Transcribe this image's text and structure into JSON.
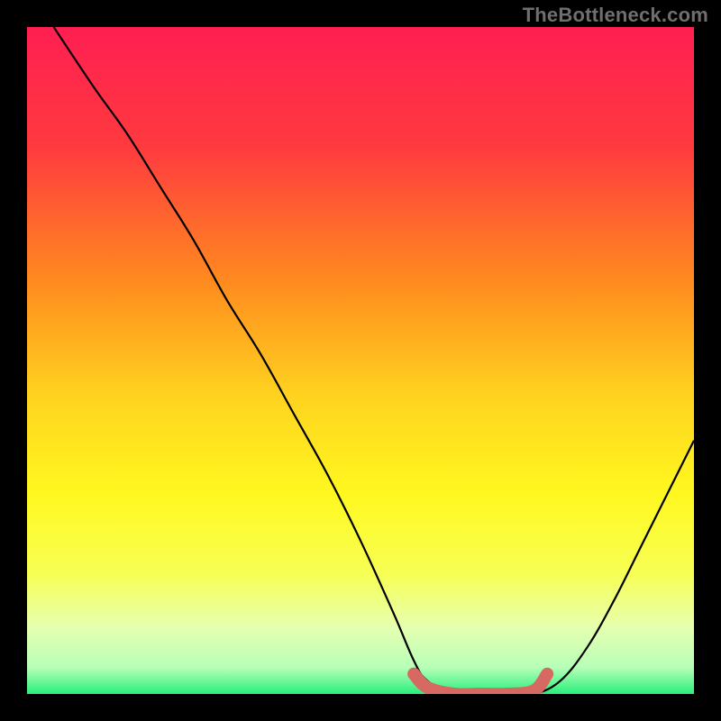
{
  "watermark": "TheBottleneck.com",
  "accent_color": "#d66a63",
  "chart_data": {
    "type": "line",
    "title": "",
    "xlabel": "",
    "ylabel": "",
    "xlim": [
      0,
      100
    ],
    "ylim": [
      0,
      100
    ],
    "series": [
      {
        "name": "curve",
        "x": [
          4,
          10,
          15,
          20,
          25,
          30,
          35,
          40,
          45,
          50,
          55,
          58,
          60,
          64,
          68,
          72,
          76,
          80,
          84,
          88,
          92,
          96,
          100
        ],
        "y": [
          100,
          91,
          84,
          76,
          68,
          59,
          51,
          42,
          33,
          23,
          12,
          5,
          2,
          0,
          0,
          0,
          0,
          2,
          7,
          14,
          22,
          30,
          38
        ]
      }
    ],
    "highlight": {
      "name": "flat-region",
      "x": [
        58,
        60,
        64,
        68,
        72,
        76,
        78
      ],
      "y": [
        3,
        1,
        0,
        0,
        0,
        0.5,
        3
      ]
    },
    "gradient_stops": [
      {
        "offset": 0.0,
        "color": "#ff1f52"
      },
      {
        "offset": 0.18,
        "color": "#ff3a3f"
      },
      {
        "offset": 0.38,
        "color": "#ff8a1f"
      },
      {
        "offset": 0.55,
        "color": "#ffd21f"
      },
      {
        "offset": 0.7,
        "color": "#fff81f"
      },
      {
        "offset": 0.82,
        "color": "#f7ff55"
      },
      {
        "offset": 0.9,
        "color": "#e6ffb0"
      },
      {
        "offset": 0.96,
        "color": "#b8ffb8"
      },
      {
        "offset": 1.0,
        "color": "#29ef7c"
      }
    ]
  }
}
